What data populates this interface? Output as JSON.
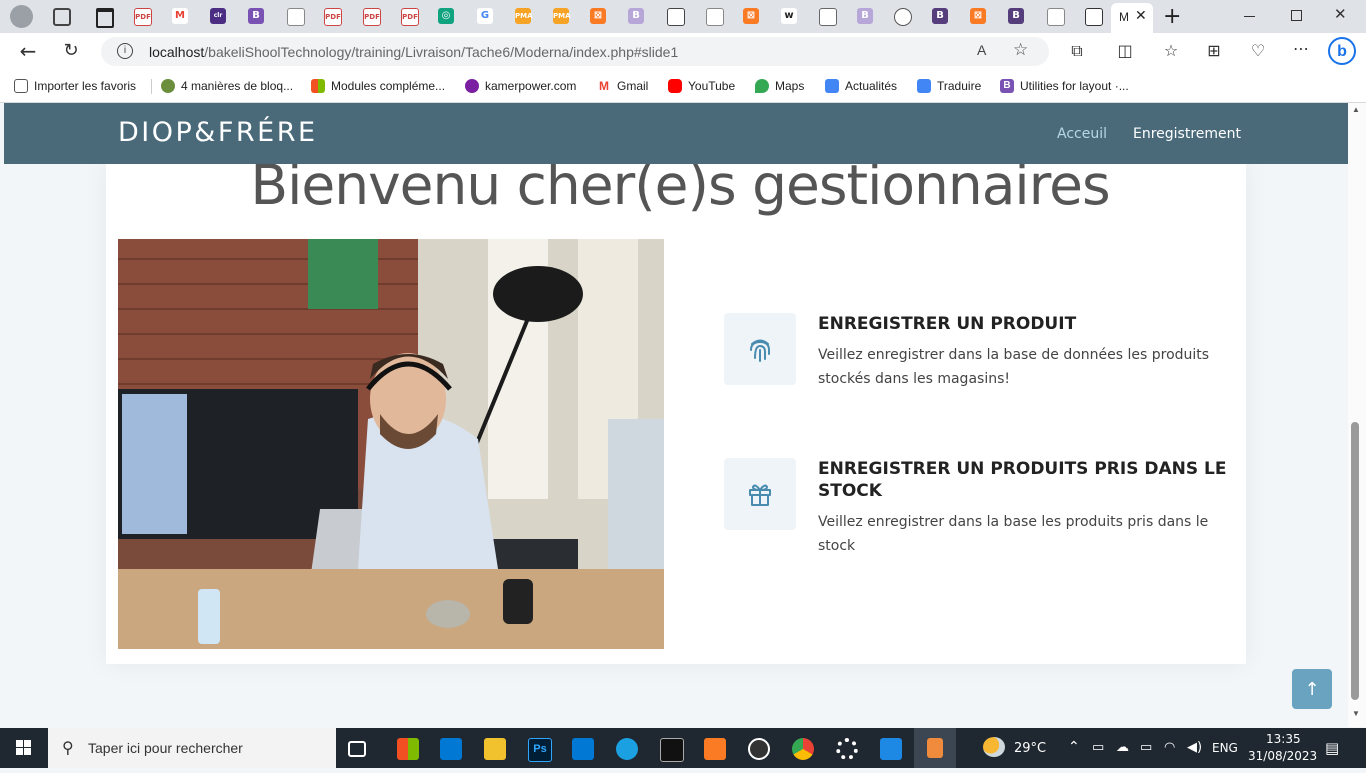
{
  "browser": {
    "active_tab_label": "M",
    "url": {
      "host": "localhost",
      "path": "/bakeliShoolTechnology/training/Livraison/Tache6/Moderna/index.php#slide1"
    },
    "bookmarks": [
      {
        "label": "Importer les favoris",
        "color": "#555555"
      },
      {
        "label": "4 manières de bloq...",
        "color": "#6a8e3b"
      },
      {
        "label": "Modules compléme...",
        "color": "#f25022"
      },
      {
        "label": "kamerpower.com",
        "color": "#7b1fa2"
      },
      {
        "label": "Gmail",
        "color": "#ea4335"
      },
      {
        "label": "YouTube",
        "color": "#ff0000"
      },
      {
        "label": "Maps",
        "color": "#34a853"
      },
      {
        "label": "Actualités",
        "color": "#4285f4"
      },
      {
        "label": "Traduire",
        "color": "#4285f4"
      },
      {
        "label": "Utilities for layout ·...",
        "color": "#7952b3"
      }
    ]
  },
  "site": {
    "brand": "DIOP&FRÉRE",
    "nav": {
      "home": "Acceuil",
      "register": "Enregistrement"
    },
    "heading": "Bienvenu cher(e)s gestionnaires",
    "features": [
      {
        "icon": "fingerprint-icon",
        "title": "ENREGISTRER UN PRODUIT",
        "desc_line1": "Veillez enregistrer dans la base de données les produits",
        "desc_line2": "stockés dans les magasins!"
      },
      {
        "icon": "gift-icon",
        "title_line1": "ENREGISTRER UN PRODUITS PRIS DANS LE",
        "title_line2": "STOCK",
        "desc_line1": "Veillez enregistrer dans la base les produits pris dans le",
        "desc_line2": "stock"
      }
    ],
    "accent_color": "#4a6a7a"
  },
  "taskbar": {
    "search_placeholder": "Taper ici pour rechercher",
    "weather": "29°C",
    "language": "ENG",
    "time": "13:35",
    "date": "31/08/2023"
  }
}
